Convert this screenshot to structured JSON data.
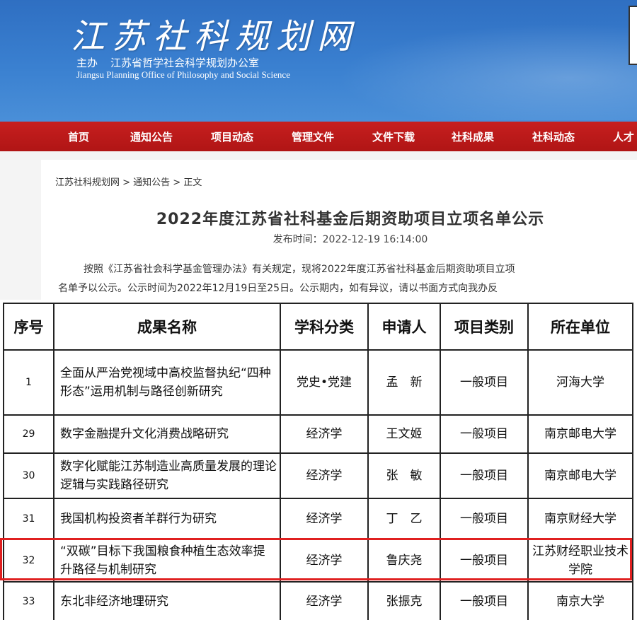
{
  "header": {
    "site_title": "江苏社科规划网",
    "host_label": "主办",
    "host_org": "江苏省哲学社会科学规划办公室",
    "host_org_en": "Jiangsu Planning Office of Philosophy and Social Science"
  },
  "nav": {
    "items": [
      "首页",
      "通知公告",
      "项目动态",
      "管理文件",
      "文件下载",
      "社科成果",
      "社科动态",
      "人才"
    ]
  },
  "breadcrumb": "江苏社科规划网 > 通知公告 > 正文",
  "article": {
    "title": "2022年度江苏省社科基金后期资助项目立项名单公示",
    "publish_time": "发布时间：2022-12-19 16:14:00",
    "para1": "按照《江苏省社会科学基金管理办法》有关规定，现将2022年度江苏省社科基金后期资助项目立项",
    "para2": "名单予以公示。公示时间为2022年12月19日至25日。公示期内，如有异议，请以书面方式向我办反"
  },
  "table": {
    "headers": [
      "序号",
      "成果名称",
      "学科分类",
      "申请人",
      "项目类别",
      "所在单位"
    ],
    "rows": [
      [
        "1",
        "全面从严治党视域中高校监督执纪“四种形态”运用机制与路径创新研究",
        "党史•党建",
        "孟　新",
        "一般项目",
        "河海大学"
      ],
      [
        "29",
        "数字金融提升文化消费战略研究",
        "经济学",
        "王文姬",
        "一般项目",
        "南京邮电大学"
      ],
      [
        "30",
        "数字化赋能江苏制造业高质量发展的理论逻辑与实践路径研究",
        "经济学",
        "张　敏",
        "一般项目",
        "南京邮电大学"
      ],
      [
        "31",
        "我国机构投资者羊群行为研究",
        "经济学",
        "丁　乙",
        "一般项目",
        "南京财经大学"
      ],
      [
        "32",
        "“双碳”目标下我国粮食种植生态效率提升路径与机制研究",
        "经济学",
        "鲁庆尧",
        "一般项目",
        "江苏财经职业技术学院"
      ],
      [
        "33",
        "东北非经济地理研究",
        "经济学",
        "张振克",
        "一般项目",
        "南京大学"
      ]
    ]
  },
  "colors": {
    "banner_blue": "#3a80d0",
    "nav_red": "#c71f1f",
    "highlight_red": "#e02020"
  }
}
